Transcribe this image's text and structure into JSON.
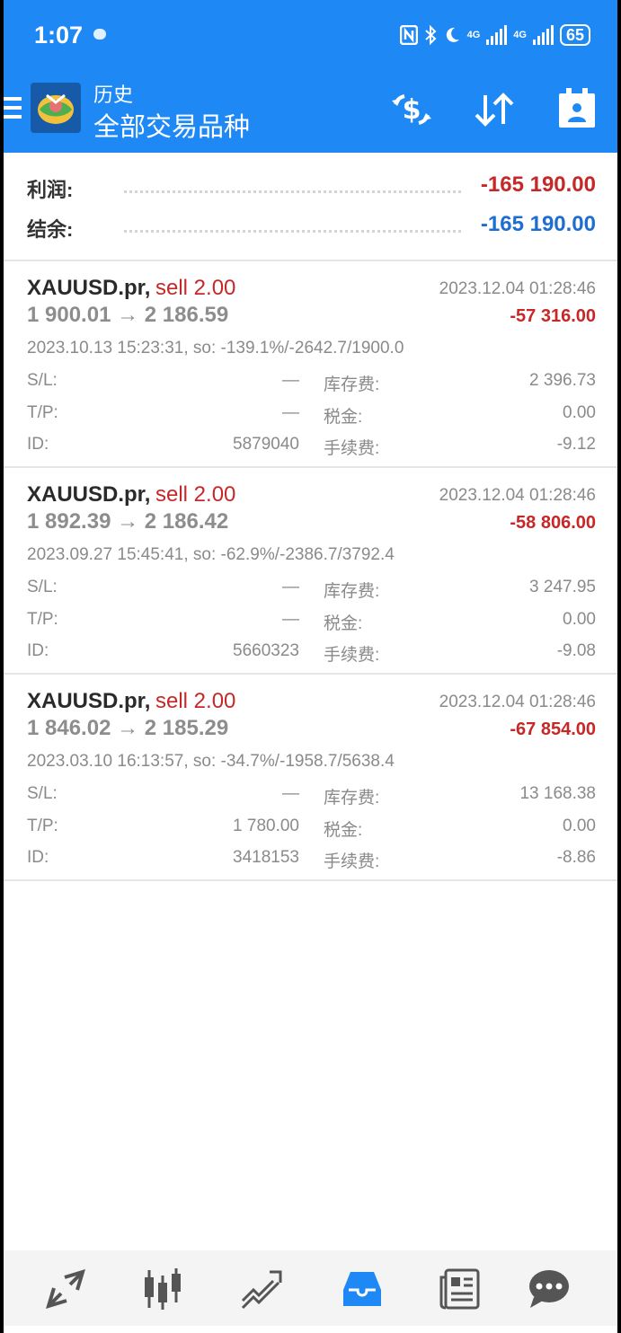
{
  "status": {
    "time": "1:07",
    "net1": "4G",
    "net2": "4G",
    "battery": "65"
  },
  "header": {
    "title_small": "历史",
    "title_big": "全部交易品种"
  },
  "summary": {
    "profit_label": "利润:",
    "profit_value": "-165 190.00",
    "balance_label": "结余:",
    "balance_value": "-165 190.00"
  },
  "labels": {
    "sl": "S/L:",
    "tp": "T/P:",
    "id": "ID:",
    "swap": "库存费:",
    "tax": "税金:",
    "commission": "手续费:"
  },
  "trades": [
    {
      "symbol": "XAUUSD.pr,",
      "side": "sell 2.00",
      "close_time": "2023.12.04 01:28:46",
      "prices": "1 900.01 → 2 186.59",
      "profit": "-57 316.00",
      "open_info": "2023.10.13 15:23:31, so: -139.1%/-2642.7/1900.0",
      "sl": "—",
      "tp": "—",
      "id": "5879040",
      "swap": "2 396.73",
      "tax": "0.00",
      "commission": "-9.12"
    },
    {
      "symbol": "XAUUSD.pr,",
      "side": "sell 2.00",
      "close_time": "2023.12.04 01:28:46",
      "prices": "1 892.39 → 2 186.42",
      "profit": "-58 806.00",
      "open_info": "2023.09.27 15:45:41, so: -62.9%/-2386.7/3792.4",
      "sl": "—",
      "tp": "—",
      "id": "5660323",
      "swap": "3 247.95",
      "tax": "0.00",
      "commission": "-9.08"
    },
    {
      "symbol": "XAUUSD.pr,",
      "side": "sell 2.00",
      "close_time": "2023.12.04 01:28:46",
      "prices": "1 846.02 → 2 185.29",
      "profit": "-67 854.00",
      "open_info": "2023.03.10 16:13:57, so: -34.7%/-1958.7/5638.4",
      "sl": "—",
      "tp": "1 780.00",
      "id": "3418153",
      "swap": "13 168.38",
      "tax": "0.00",
      "commission": "-8.86"
    }
  ],
  "colors": {
    "accent": "#1e88f5",
    "loss": "#c62828",
    "balance": "#1e6ed1",
    "nav_active": "#1e88f5",
    "nav_inactive": "#555555"
  },
  "icons": {
    "toolbar": [
      "currency-exchange-icon",
      "sort-icon",
      "calendar-icon"
    ],
    "nav": [
      "quotes-icon",
      "chart-icon",
      "trade-icon",
      "history-icon",
      "news-icon",
      "messages-icon"
    ]
  }
}
